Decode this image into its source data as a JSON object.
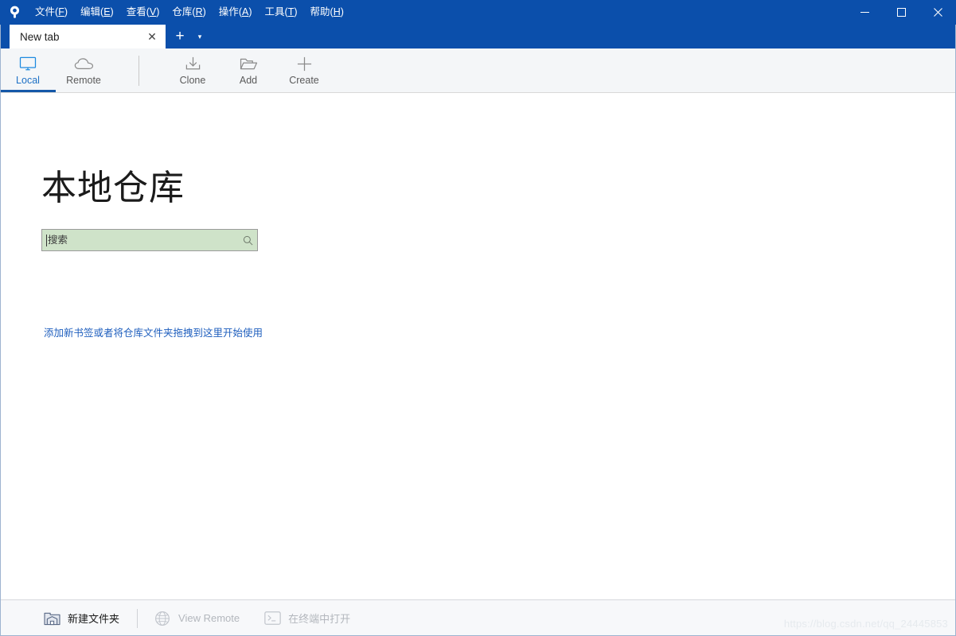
{
  "app": {
    "logo_icon": "sourcetree-logo-icon",
    "titlebar_color": "#0b4fab",
    "accent_color": "#1458a8",
    "link_color": "#1f5fbe"
  },
  "menu": {
    "items": [
      {
        "label": "文件",
        "mnemonic": "F",
        "name": "menu-file"
      },
      {
        "label": "编辑",
        "mnemonic": "E",
        "name": "menu-edit"
      },
      {
        "label": "查看",
        "mnemonic": "V",
        "name": "menu-view"
      },
      {
        "label": "仓库",
        "mnemonic": "R",
        "name": "menu-repository"
      },
      {
        "label": "操作",
        "mnemonic": "A",
        "name": "menu-actions"
      },
      {
        "label": "工具",
        "mnemonic": "T",
        "name": "menu-tools"
      },
      {
        "label": "帮助",
        "mnemonic": "H",
        "name": "menu-help"
      }
    ]
  },
  "window_controls": {
    "minimize": "−",
    "maximize": "☐",
    "close": "✕"
  },
  "tabs": {
    "items": [
      {
        "label": "New tab",
        "active": true,
        "close_glyph": "✕"
      }
    ],
    "new_tab_glyph": "+",
    "dropdown_glyph": "▾"
  },
  "toolbar": {
    "items": [
      {
        "label": "Local",
        "icon": "monitor-icon",
        "active": true
      },
      {
        "label": "Remote",
        "icon": "cloud-icon",
        "active": false
      },
      {
        "label": "Clone",
        "icon": "download-icon",
        "active": false
      },
      {
        "label": "Add",
        "icon": "open-folder-icon",
        "active": false
      },
      {
        "label": "Create",
        "icon": "plus-icon",
        "active": false
      }
    ]
  },
  "main": {
    "title": "本地仓库",
    "search": {
      "placeholder": "搜索",
      "value": "",
      "icon": "search-icon",
      "background_color": "#cfe3c9"
    },
    "hint": "添加新书签或者将仓库文件夹拖拽到这里开始使用"
  },
  "statusbar": {
    "new_folder": {
      "label": "新建文件夹",
      "icon": "repository-folder-icon",
      "enabled": true
    },
    "view_remote": {
      "label": "View Remote",
      "icon": "globe-icon",
      "enabled": false
    },
    "open_terminal": {
      "label": "在终端中打开",
      "icon": "terminal-icon",
      "enabled": false
    },
    "watermark": "https://blog.csdn.net/qq_24445853"
  }
}
